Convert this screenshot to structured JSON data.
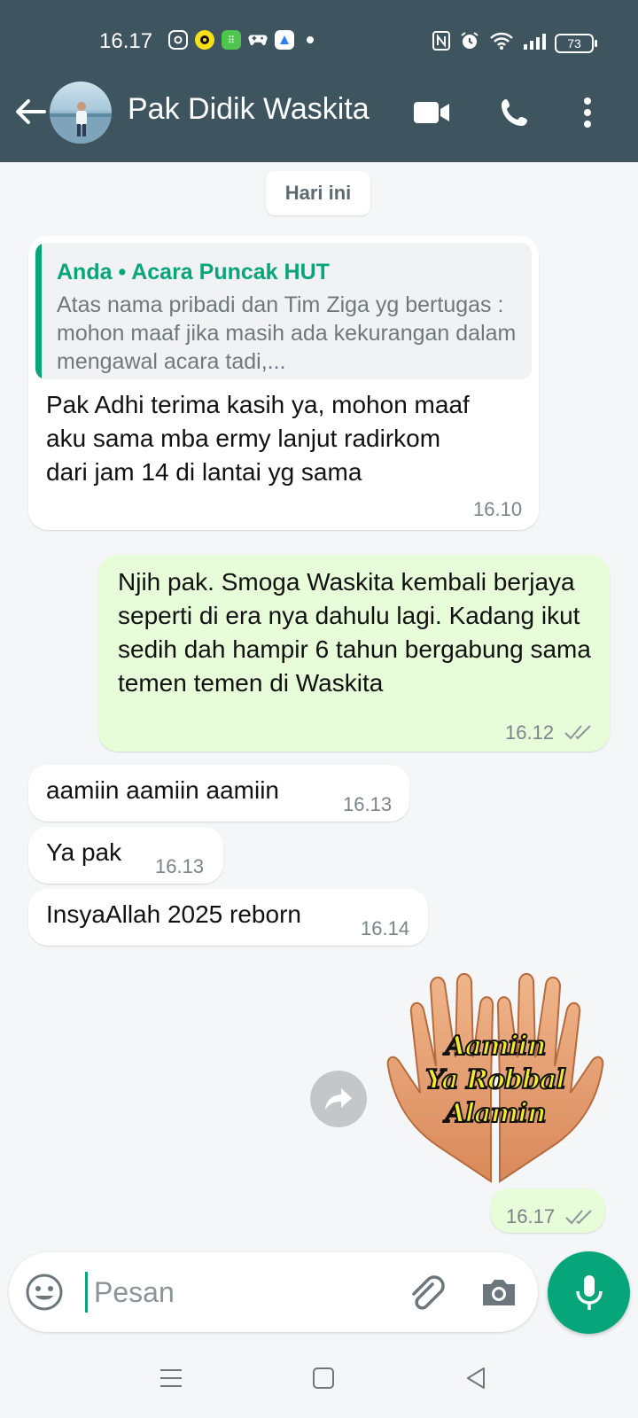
{
  "status_bar": {
    "time": "16.17",
    "battery": "73",
    "icons_left": [
      "instagram-icon",
      "media-app-icon",
      "green-app-icon",
      "gamepad-icon",
      "blue-app-icon",
      "notification-dot"
    ],
    "icons_right": [
      "nfc-icon",
      "alarm-icon",
      "wifi-icon",
      "signal-icon",
      "battery-icon"
    ]
  },
  "header": {
    "contact_name": "Pak Didik Waskita",
    "background_color": "#3e5560"
  },
  "chat": {
    "date_chip": "Hari ini",
    "messages": [
      {
        "direction": "in",
        "quote_author": "Anda • Acara Puncak HUT",
        "quote_text": "Atas nama pribadi dan Tim Ziga yg bertugas : mohon maaf jika masih ada kekurangan dalam mengawal acara tadi,...",
        "text": "Pak Adhi terima kasih ya, mohon maaf aku sama mba ermy lanjut radirkom dari jam 14 di lantai yg sama",
        "time": "16.10"
      },
      {
        "direction": "out",
        "text": "Njih pak. Smoga Waskita kembali berjaya seperti di era nya dahulu lagi. Kadang ikut sedih dah hampir 6 tahun bergabung sama temen temen di Waskita",
        "time": "16.12",
        "status": "read"
      },
      {
        "direction": "in",
        "text": "aamiin aamiin aamiin",
        "time": "16.13"
      },
      {
        "direction": "in",
        "text": "Ya pak",
        "time": "16.13"
      },
      {
        "direction": "in",
        "text": "InsyaAllah 2025 reborn",
        "time": "16.14"
      },
      {
        "direction": "out",
        "type": "sticker",
        "sticker_lines": [
          "Aamiin",
          "Ya Robbal",
          "Alamin"
        ],
        "time": "16.17",
        "status": "read"
      }
    ]
  },
  "input": {
    "placeholder": "Pesan"
  },
  "colors": {
    "accent": "#06a67a",
    "outgoing_bubble": "#e7fcd8",
    "incoming_bubble": "#ffffff",
    "chat_background": "#f5f6f7"
  }
}
